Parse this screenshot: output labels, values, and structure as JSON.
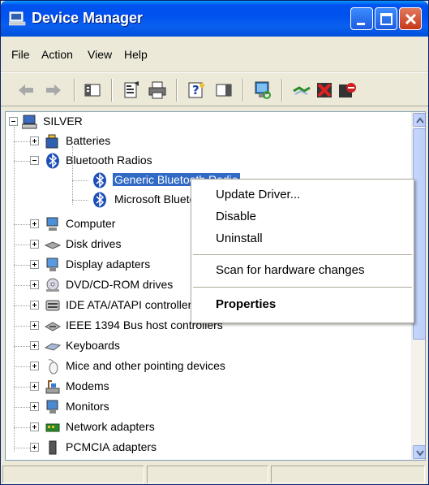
{
  "window": {
    "title": "Device Manager",
    "title_icon": "computer-icon",
    "controls": [
      "minimize",
      "maximize",
      "close"
    ]
  },
  "menubar": {
    "items": [
      "File",
      "Action",
      "View",
      "Help"
    ]
  },
  "toolbar": {
    "icons": [
      "back-arrow-icon",
      "forward-arrow-icon",
      "show-hide-console-tree-icon",
      "properties-icon",
      "print-icon",
      "help-icon",
      "show-hide-action-pane-icon",
      "scan-hardware-icon",
      "uninstall-icon",
      "disable-icon",
      "update-driver-icon"
    ]
  },
  "tree": {
    "root": "SILVER",
    "items": [
      {
        "label": "Batteries",
        "icon": "battery-icon",
        "expander": "plus"
      },
      {
        "label": "Bluetooth Radios",
        "icon": "bluetooth-icon",
        "expander": "minus"
      },
      {
        "label": "Generic Bluetooth Radio",
        "icon": "bluetooth-icon",
        "child": true,
        "selected": true
      },
      {
        "label": "Microsoft Bluetooth Enumerator",
        "icon": "bluetooth-icon",
        "child": true
      },
      {
        "label": "Computer",
        "icon": "computer-icon",
        "expander": "plus"
      },
      {
        "label": "Disk drives",
        "icon": "disk-drive-icon",
        "expander": "plus"
      },
      {
        "label": "Display adapters",
        "icon": "display-adapter-icon",
        "expander": "plus"
      },
      {
        "label": "DVD/CD-ROM drives",
        "icon": "cdrom-icon",
        "expander": "plus"
      },
      {
        "label": "IDE ATA/ATAPI controllers",
        "icon": "ide-controller-icon",
        "expander": "plus"
      },
      {
        "label": "IEEE 1394 Bus host controllers",
        "icon": "firewire-icon",
        "expander": "plus"
      },
      {
        "label": "Keyboards",
        "icon": "keyboard-icon",
        "expander": "plus"
      },
      {
        "label": "Mice and other pointing devices",
        "icon": "mouse-icon",
        "expander": "plus"
      },
      {
        "label": "Modems",
        "icon": "modem-icon",
        "expander": "plus"
      },
      {
        "label": "Monitors",
        "icon": "monitor-icon",
        "expander": "plus"
      },
      {
        "label": "Network adapters",
        "icon": "network-adapter-icon",
        "expander": "plus"
      },
      {
        "label": "PCMCIA adapters",
        "icon": "pcmcia-icon",
        "expander": "plus"
      }
    ]
  },
  "context_menu": {
    "items": [
      "Update Driver...",
      "Disable",
      "Uninstall",
      "Scan for hardware changes",
      "Properties"
    ]
  },
  "colors": {
    "titlebar": "#0050EE",
    "selection": "#316AC5",
    "chrome": "#ECE9D8"
  }
}
